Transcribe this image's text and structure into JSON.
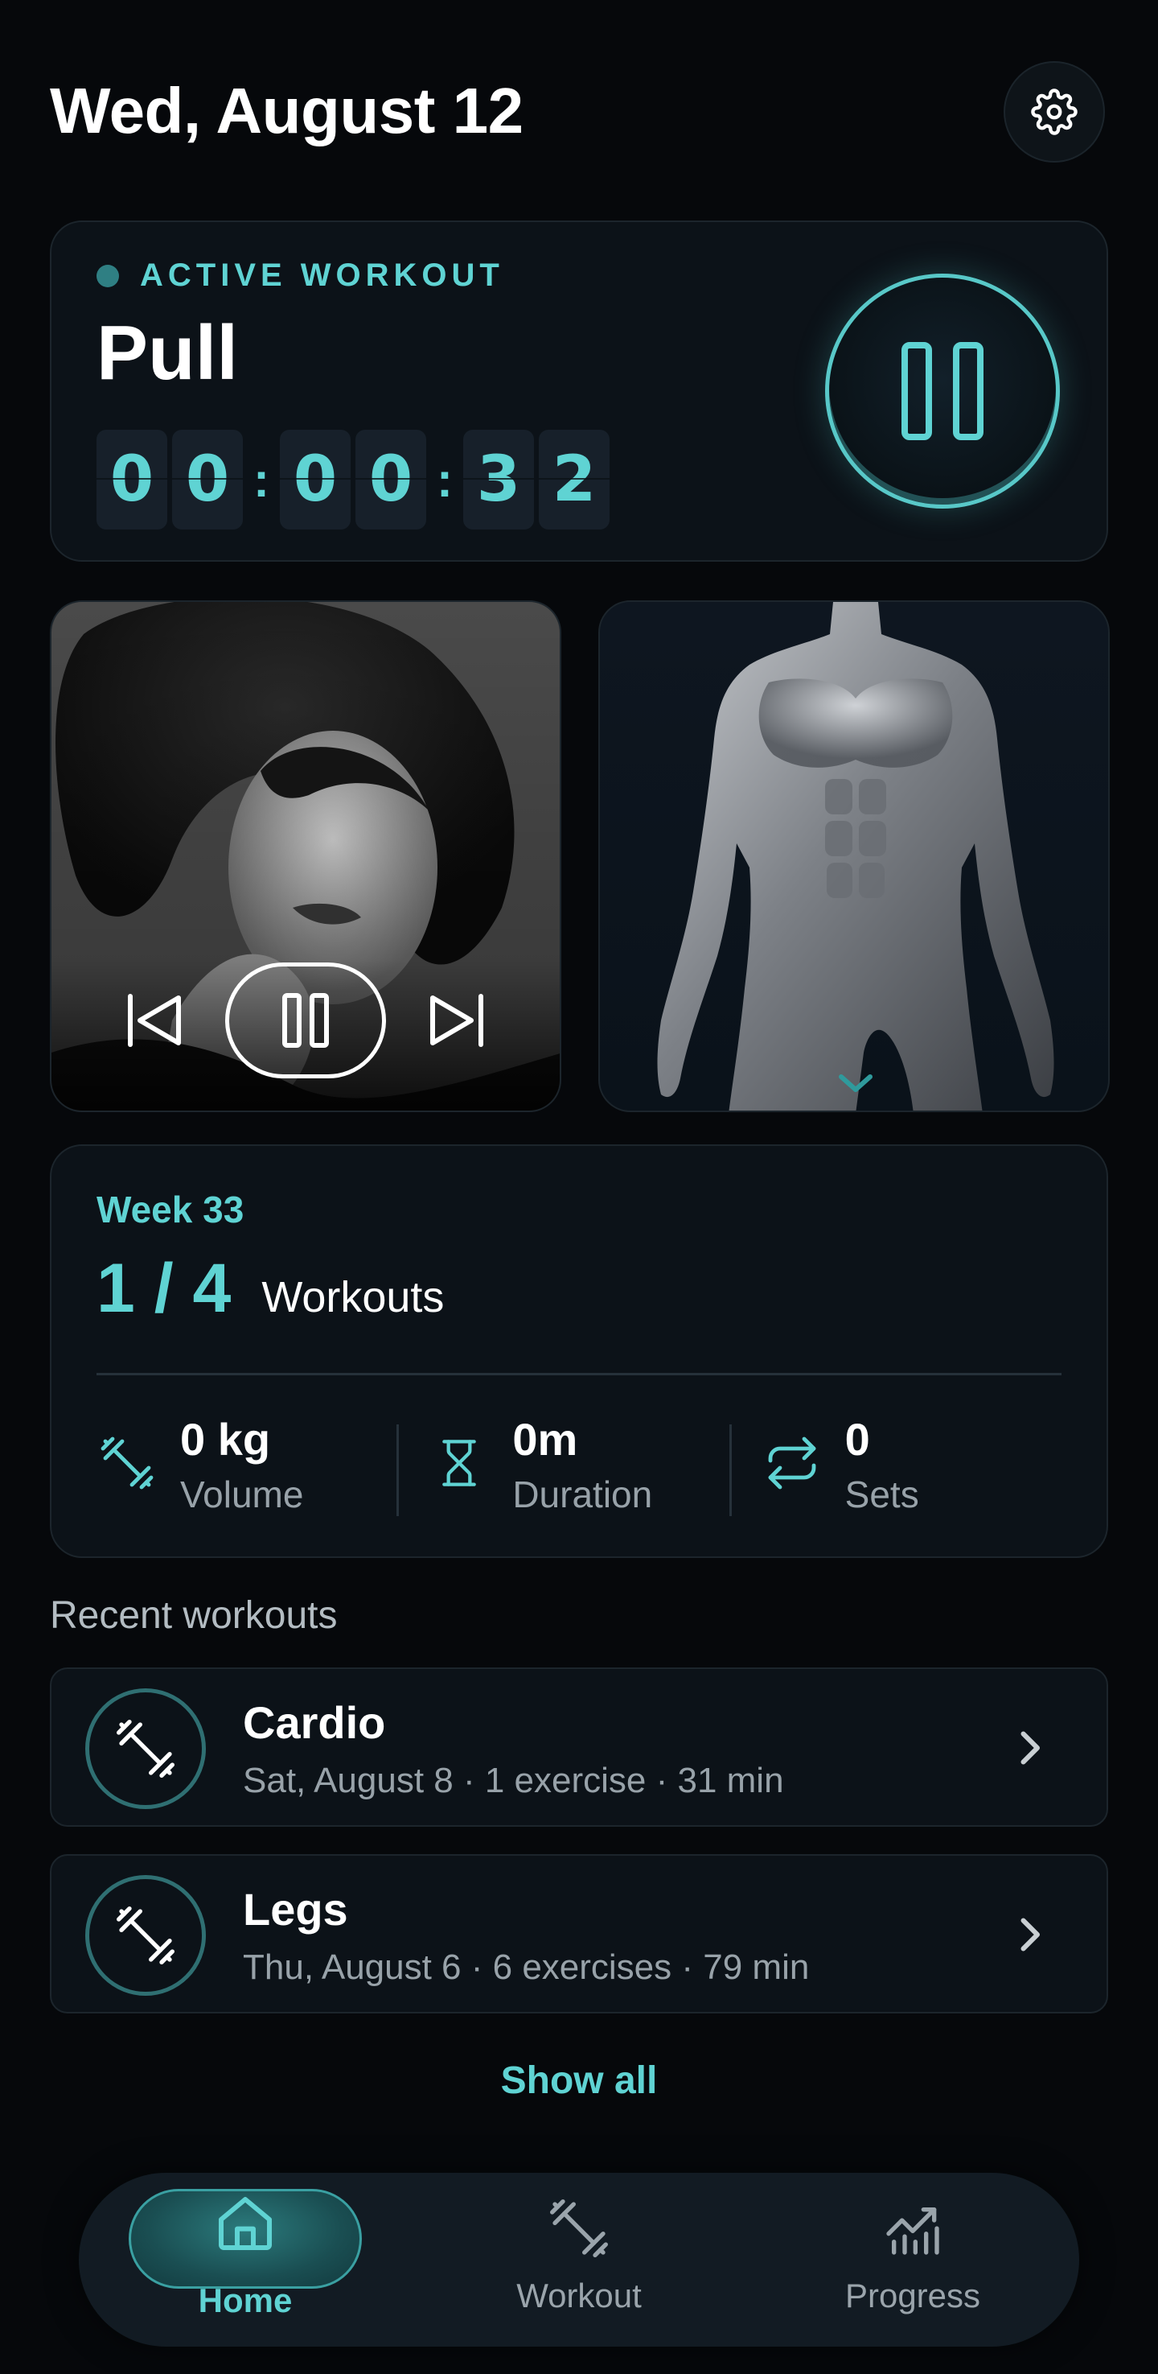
{
  "header": {
    "date": "Wed, August 12"
  },
  "active_workout": {
    "label": "ACTIVE WORKOUT",
    "name": "Pull",
    "timer_digits": [
      "0",
      "0",
      "0",
      "0",
      "3",
      "2"
    ]
  },
  "week": {
    "label": "Week 33",
    "progress": "1 / 4",
    "progress_label": "Workouts",
    "stats": [
      {
        "value": "0 kg",
        "label": "Volume",
        "icon": "dumbbell-icon"
      },
      {
        "value": "0m",
        "label": "Duration",
        "icon": "hourglass-icon"
      },
      {
        "value": "0",
        "label": "Sets",
        "icon": "repeat-icon"
      }
    ]
  },
  "recent": {
    "title": "Recent workouts",
    "items": [
      {
        "title": "Cardio",
        "subtitle": "Sat, August 8 · 1 exercise · 31 min"
      },
      {
        "title": "Legs",
        "subtitle": "Thu, August 6 · 6 exercises · 79 min"
      }
    ],
    "show_all": "Show all"
  },
  "nav": {
    "items": [
      {
        "label": "Home",
        "icon": "home-icon",
        "active": true
      },
      {
        "label": "Workout",
        "icon": "dumbbell-icon",
        "active": false
      },
      {
        "label": "Progress",
        "icon": "chart-icon",
        "active": false
      }
    ]
  },
  "colors": {
    "accent": "#5fd3d3",
    "background": "#06080b",
    "card": "#0c1218"
  }
}
